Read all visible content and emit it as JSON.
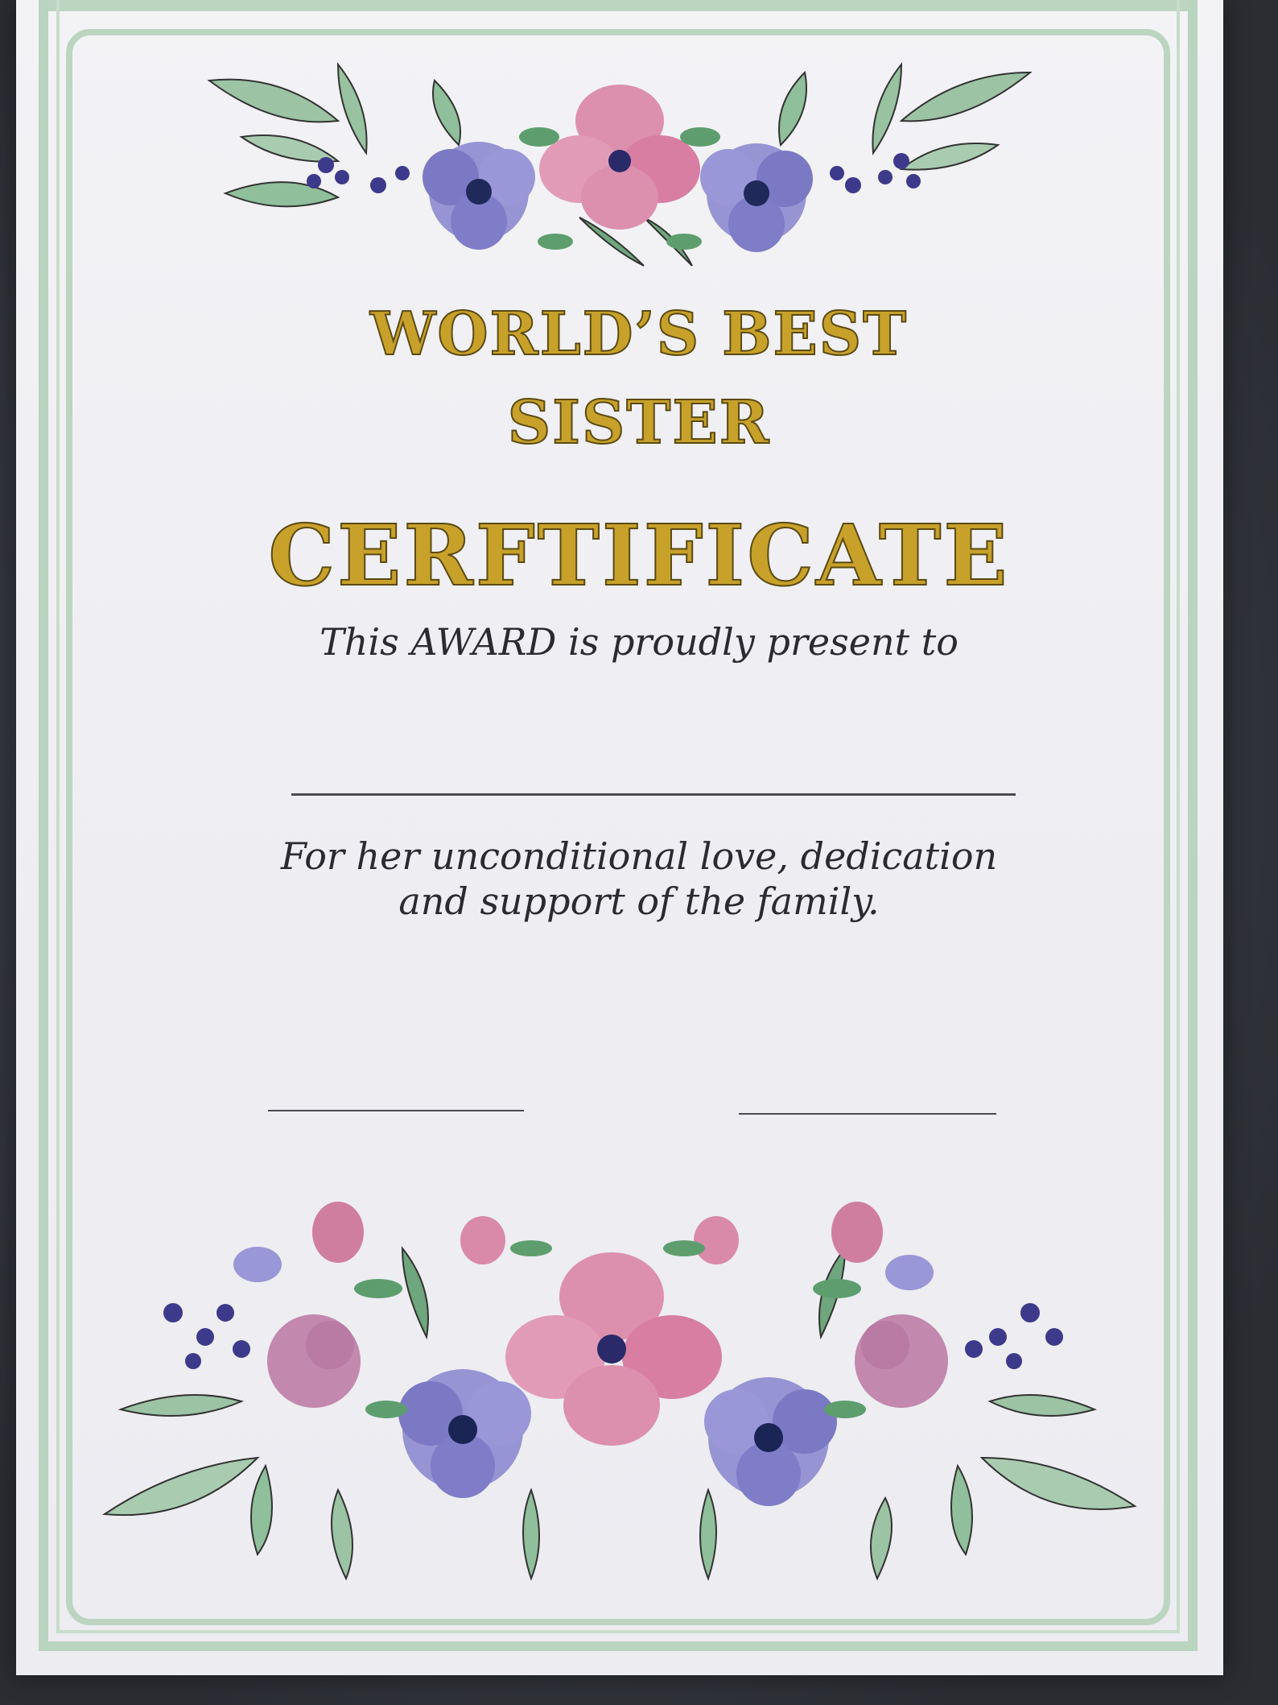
{
  "certificate": {
    "title_line1": "WORLD’S BEST",
    "title_line2": "SISTER",
    "title_main": "CERFTIFICATE",
    "presented_text": "This AWARD is proudly present to",
    "reason_line1": "For her unconditional love, dedication",
    "reason_line2": "and support of the family."
  },
  "colors": {
    "title_gold": "#c7a12a",
    "border_green": "#bcd5c1",
    "flower_pink": "#d98aa8",
    "flower_purple": "#8a86cc",
    "leaf_green": "#7fb38f"
  },
  "decorations": {
    "top": "floral-garland",
    "bottom": "floral-garland"
  }
}
